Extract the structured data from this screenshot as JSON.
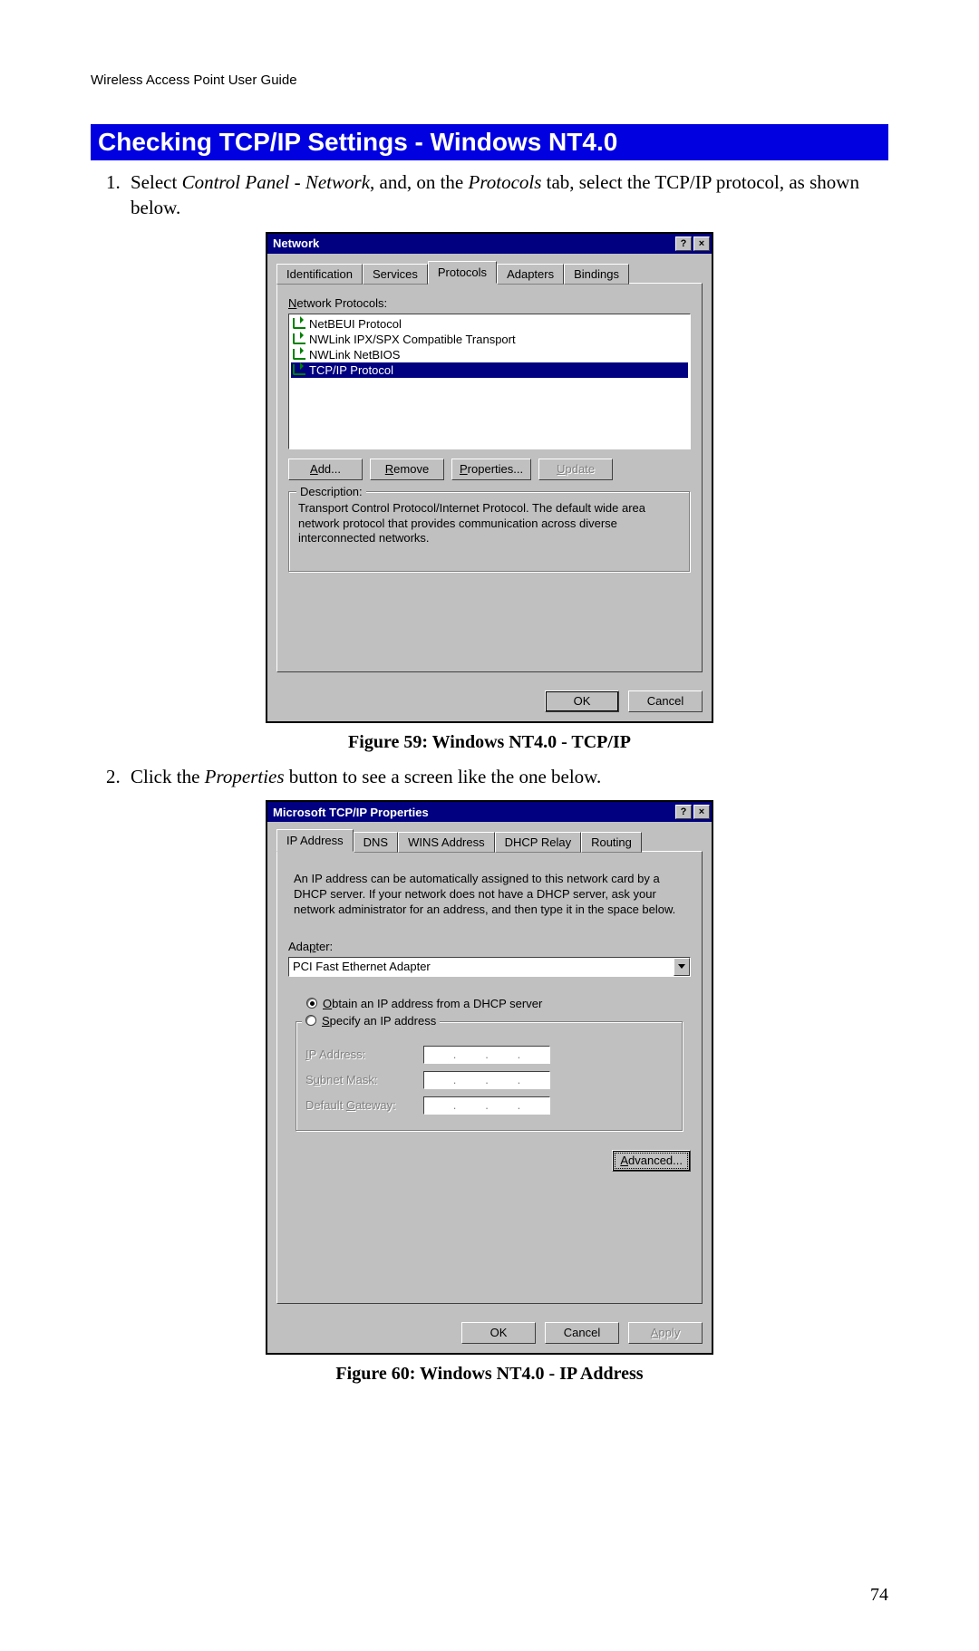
{
  "header": "Wireless Access Point User Guide",
  "section_heading": "Checking TCP/IP Settings - Windows NT4.0",
  "step1_a": "Select ",
  "step1_em1": "Control Panel - Network",
  "step1_b": ", and, on the ",
  "step1_em2": "Protocols",
  "step1_c": " tab, select the TCP/IP protocol, as shown below.",
  "fig59_caption": "Figure 59: Windows NT4.0 - TCP/IP",
  "step2_a": "Click the ",
  "step2_em": "Properties",
  "step2_b": " button to see a screen like the one below.",
  "fig60_caption": "Figure 60: Windows NT4.0 - IP Address",
  "page_number": "74",
  "network_dialog": {
    "title": "Network",
    "tabs": [
      "Identification",
      "Services",
      "Protocols",
      "Adapters",
      "Bindings"
    ],
    "active_tab": "Protocols",
    "list_label_u": "N",
    "list_label_rest": "etwork Protocols:",
    "items": [
      "NetBEUI Protocol",
      "NWLink IPX/SPX Compatible Transport",
      "NWLink NetBIOS",
      "TCP/IP Protocol"
    ],
    "selected_item": "TCP/IP Protocol",
    "btn_add_u": "A",
    "btn_add_rest": "dd...",
    "btn_remove_u": "R",
    "btn_remove_rest": "emove",
    "btn_props_u": "P",
    "btn_props_rest": "roperties...",
    "btn_update_u": "U",
    "btn_update_rest": "pdate",
    "desc_legend": "Description:",
    "desc_text": "Transport Control Protocol/Internet Protocol. The default wide area network protocol that provides communication across diverse interconnected networks.",
    "ok": "OK",
    "cancel": "Cancel",
    "help": "?",
    "close": "×"
  },
  "tcpip_dialog": {
    "title": "Microsoft TCP/IP Properties",
    "tabs": [
      "IP Address",
      "DNS",
      "WINS Address",
      "DHCP Relay",
      "Routing"
    ],
    "active_tab": "IP Address",
    "intro": "An IP address can be automatically assigned to this network card by a DHCP server.  If your network does not have a DHCP server, ask your network administrator for an address, and then type it in the space below.",
    "adapter_label_u": "p",
    "adapter_label_pre": "Ada",
    "adapter_label_post": "ter:",
    "adapter_value": "PCI Fast Ethernet Adapter",
    "radio_obtain_u": "O",
    "radio_obtain_rest": "btain an IP address from a DHCP server",
    "radio_specify_u": "S",
    "radio_specify_rest": "pecify an IP address",
    "ip_label_u": "I",
    "ip_label_rest": "P Address:",
    "subnet_label_pre": "S",
    "subnet_label_u": "u",
    "subnet_label_rest": "bnet Mask:",
    "gateway_label_pre": "Default ",
    "gateway_label_u": "G",
    "gateway_label_rest": "ateway:",
    "advanced_u": "A",
    "advanced_rest": "dvanced...",
    "ok": "OK",
    "cancel": "Cancel",
    "apply_u": "A",
    "apply_rest": "pply",
    "help": "?",
    "close": "×"
  }
}
